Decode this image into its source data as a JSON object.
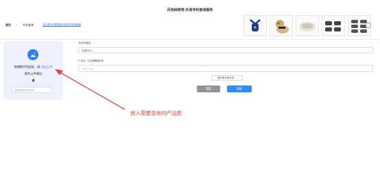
{
  "header": {
    "title": "月亮树跨境-外观专利查询服务"
  },
  "breadcrumb": {
    "home": "首页",
    "current": "专利查询",
    "link": "亚马逊专利数据库外观专利查询指南"
  },
  "thumbnails": [
    {
      "icon": "dog-harness-product-image"
    },
    {
      "icon": "dog-wearing-harness-image"
    },
    {
      "icon": "pet-bed-product-image"
    },
    {
      "icon": "sunglasses-product-image"
    },
    {
      "icon": "sunglasses-set-product-image"
    }
  ],
  "upload": {
    "hint_prefix": "拖拽图片到此处，或",
    "hint_link": "点击上传",
    "tip": "图片上传建议",
    "or": "或",
    "paste_placeholder": "粘贴截图/图片链接"
  },
  "form": {
    "region_label": "专利所属国",
    "region_value": "全部(ALL)",
    "product_label": "产品名（支持模糊查询）",
    "product_placeholder": "专利产品名",
    "more_filters": "展开更多填写项",
    "reset": "重置",
    "search": "搜索"
  },
  "annotation": {
    "text": "放入需要查询的产品图",
    "color": "#e04646"
  },
  "colors": {
    "accent": "#2f8cf5",
    "panel": "#eef0fb",
    "reset": "#8d949e"
  }
}
